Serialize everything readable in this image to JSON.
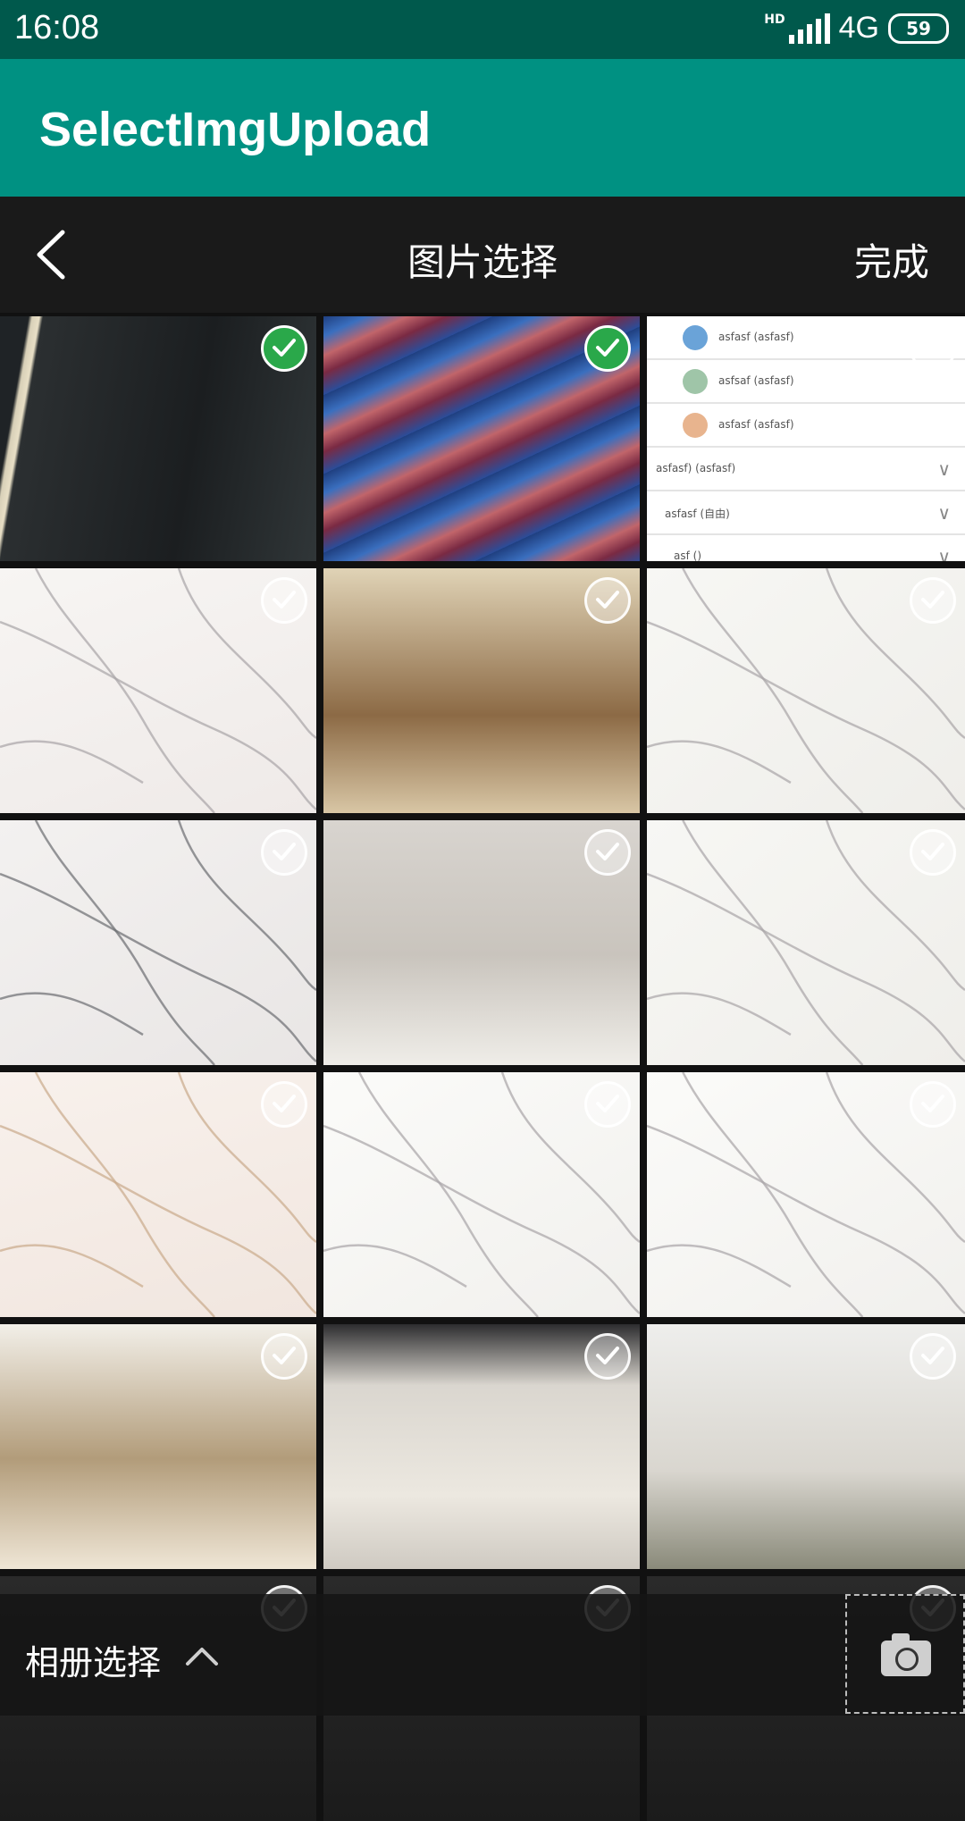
{
  "status_bar": {
    "time": "16:08",
    "network": "4G",
    "hd_label": "HD",
    "battery": "59"
  },
  "app_bar": {
    "title": "SelectImgUpload"
  },
  "toolbar": {
    "title": "图片选择",
    "done_label": "完成"
  },
  "grid": {
    "columns": 3,
    "tiles": [
      {
        "kind": "photo-dark",
        "selected": true
      },
      {
        "kind": "photo-swirl",
        "selected": true
      },
      {
        "kind": "screenshot-list",
        "selected": false
      },
      {
        "kind": "marble",
        "selected": false
      },
      {
        "kind": "room",
        "selected": false
      },
      {
        "kind": "marble-light",
        "selected": false
      },
      {
        "kind": "marble-gray",
        "selected": false
      },
      {
        "kind": "room-tv",
        "selected": false
      },
      {
        "kind": "marble-light",
        "selected": false
      },
      {
        "kind": "marble-beige",
        "selected": false
      },
      {
        "kind": "marble-white",
        "selected": false
      },
      {
        "kind": "marble-white",
        "selected": false
      },
      {
        "kind": "room-panorama",
        "selected": false
      },
      {
        "kind": "room-living",
        "selected": false
      },
      {
        "kind": "room-sofa",
        "selected": false
      },
      {
        "kind": "room-dim",
        "selected": false
      },
      {
        "kind": "room-dim",
        "selected": false
      },
      {
        "kind": "room-dim",
        "selected": false
      }
    ]
  },
  "screenshot_list": {
    "rows": [
      "asfasf (asfasf)",
      "asfsaf (asfasf)",
      "asfasf (asfasf)",
      "asfasf) (asfasf)",
      "asfasf (自由)",
      "asf ()"
    ]
  },
  "bottom_bar": {
    "album_label": "相册选择",
    "camera_icon": "camera-icon",
    "caret_icon": "chevron-up-icon"
  },
  "colors": {
    "status": "#00594c",
    "app_bar": "#009182",
    "toolbar": "#1a1a1a",
    "check_selected": "#2aa84a"
  }
}
